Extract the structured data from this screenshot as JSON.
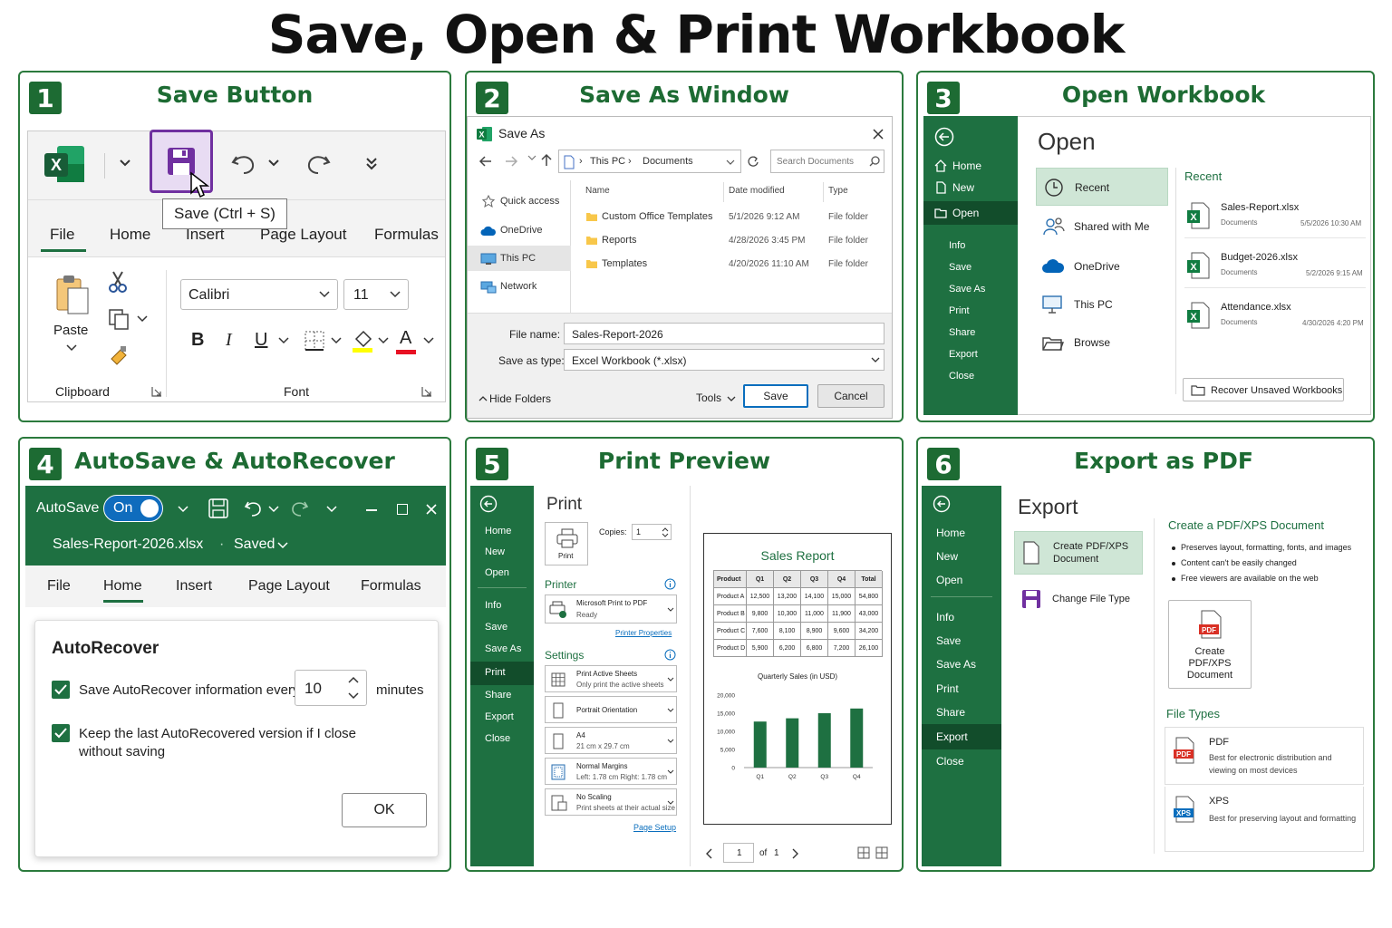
{
  "title": "Save, Open & Print Workbook",
  "colors": {
    "excel_green": "#1e7041",
    "panel_border": "#2b7a3d",
    "highlight": "#7030a0",
    "link_blue": "#0a6ebd"
  },
  "p1": {
    "num": "1",
    "title": "Save Button",
    "tooltip": "Save (Ctrl + S)",
    "tabs": [
      "File",
      "Home",
      "Insert",
      "Page Layout",
      "Formulas"
    ],
    "paste": "Paste",
    "clipboard": "Clipboard",
    "font_name": "Calibri",
    "font_size": "11",
    "font_group": "Font",
    "bold": "B",
    "italic": "I",
    "underline": "U",
    "font_color": "A"
  },
  "p2": {
    "num": "2",
    "title": "Save As Window",
    "window": "Save As",
    "path": [
      "This PC",
      "Documents"
    ],
    "search": "Search Documents",
    "nav": [
      "Quick access",
      "OneDrive",
      "This PC",
      "Network"
    ],
    "headers": [
      "Name",
      "Date modified",
      "Type"
    ],
    "files": [
      {
        "name": "Custom Office Templates",
        "date": "5/1/2026  9:12 AM",
        "type": "File folder"
      },
      {
        "name": "Reports",
        "date": "4/28/2026  3:45 PM",
        "type": "File folder"
      },
      {
        "name": "Templates",
        "date": "4/20/2026  11:10 AM",
        "type": "File folder"
      }
    ],
    "file_name_label": "File name:",
    "file_name": "Sales-Report-2026",
    "type_label": "Save as type:",
    "type_value": "Excel Workbook (*.xlsx)",
    "hide": "Hide Folders",
    "tools": "Tools",
    "save": "Save",
    "cancel": "Cancel"
  },
  "p3": {
    "num": "3",
    "title": "Open Workbook",
    "nav_top": [
      "Home",
      "New",
      "Open"
    ],
    "nav": [
      "Info",
      "Save",
      "Save As",
      "Print",
      "Share",
      "Export",
      "Close"
    ],
    "heading": "Open",
    "locations": [
      "Recent",
      "Shared with Me",
      "OneDrive",
      "This PC",
      "Browse"
    ],
    "recent_label": "Recent",
    "recent": [
      {
        "name": "Sales-Report.xlsx",
        "loc": "Documents",
        "date": "5/5/2026  10:30 AM"
      },
      {
        "name": "Budget-2026.xlsx",
        "loc": "Documents",
        "date": "5/2/2026  9:15 AM"
      },
      {
        "name": "Attendance.xlsx",
        "loc": "Documents",
        "date": "4/30/2026  4:20 PM"
      }
    ],
    "recover": "Recover Unsaved Workbooks"
  },
  "p4": {
    "num": "4",
    "title": "AutoSave & AutoRecover",
    "autosave": "AutoSave",
    "on": "On",
    "filename": "Sales-Report-2026.xlsx",
    "saved": "Saved",
    "tabs": [
      "File",
      "Home",
      "Insert",
      "Page Layout",
      "Formulas"
    ],
    "heading": "AutoRecover",
    "opt1": "Save AutoRecover information every",
    "minutes_value": "10",
    "minutes": "minutes",
    "opt2a": "Keep the last AutoRecovered version if I close",
    "opt2b": "without saving",
    "ok": "OK"
  },
  "p5": {
    "num": "5",
    "title": "Print Preview",
    "nav": [
      "Home",
      "New",
      "Open",
      "Info",
      "Save",
      "Save As",
      "Print",
      "Share",
      "Export",
      "Close"
    ],
    "heading": "Print",
    "print_btn": "Print",
    "copies_label": "Copies:",
    "copies": "1",
    "printer_label": "Printer",
    "printer_name": "Microsoft Print to PDF",
    "printer_status": "Ready",
    "printer_props": "Printer Properties",
    "settings_label": "Settings",
    "settings": [
      {
        "l1": "Print Active Sheets",
        "l2": "Only print the active sheets"
      },
      {
        "l1": "Portrait Orientation",
        "l2": ""
      },
      {
        "l1": "A4",
        "l2": "21 cm x 29.7 cm"
      },
      {
        "l1": "Normal Margins",
        "l2": "Left: 1.78 cm    Right: 1.78 cm"
      },
      {
        "l1": "No Scaling",
        "l2": "Print sheets at their actual size"
      }
    ],
    "page_setup": "Page Setup",
    "page": "1",
    "of": "of",
    "pages": "1",
    "report_title": "Sales Report",
    "table": {
      "headers": [
        "Product",
        "Q1",
        "Q2",
        "Q3",
        "Q4",
        "Total"
      ],
      "rows": [
        [
          "Product A",
          "12,500",
          "13,200",
          "14,100",
          "15,000",
          "54,800"
        ],
        [
          "Product B",
          "9,800",
          "10,300",
          "11,000",
          "11,900",
          "43,000"
        ],
        [
          "Product C",
          "7,600",
          "8,100",
          "8,900",
          "9,600",
          "34,200"
        ],
        [
          "Product D",
          "5,900",
          "6,200",
          "6,800",
          "7,200",
          "26,100"
        ]
      ]
    }
  },
  "chart_data": {
    "type": "bar",
    "title": "Quarterly Sales (in USD)",
    "categories": [
      "Q1",
      "Q2",
      "Q3",
      "Q4"
    ],
    "values": [
      12700,
      13600,
      15000,
      16300
    ],
    "yticks": [
      "20,000",
      "15,000",
      "10,000",
      "5,000",
      "0"
    ],
    "ylim": [
      0,
      20000
    ],
    "grid": false,
    "color": "#1e7041"
  },
  "p6": {
    "num": "6",
    "title": "Export as PDF",
    "nav": [
      "Home",
      "New",
      "Open",
      "Info",
      "Save",
      "Save As",
      "Print",
      "Share",
      "Export",
      "Close"
    ],
    "heading": "Export",
    "opt1a": "Create PDF/XPS",
    "opt1b": "Document",
    "opt2": "Change File Type",
    "create_title": "Create a PDF/XPS Document",
    "bullets": [
      "Preserves layout, formatting, fonts, and images",
      "Content can't be easily changed",
      "Free viewers are available on the web"
    ],
    "btn1": "Create",
    "btn2": "PDF/XPS",
    "btn3": "Document",
    "pdf_badge": "PDF",
    "file_types": "File Types",
    "pdf": "PDF",
    "pdf_d1": "Best for electronic distribution and",
    "pdf_d2": "viewing on most devices",
    "xps": "XPS",
    "xps_badge": "XPS",
    "xps_d": "Best for preserving layout and formatting"
  }
}
